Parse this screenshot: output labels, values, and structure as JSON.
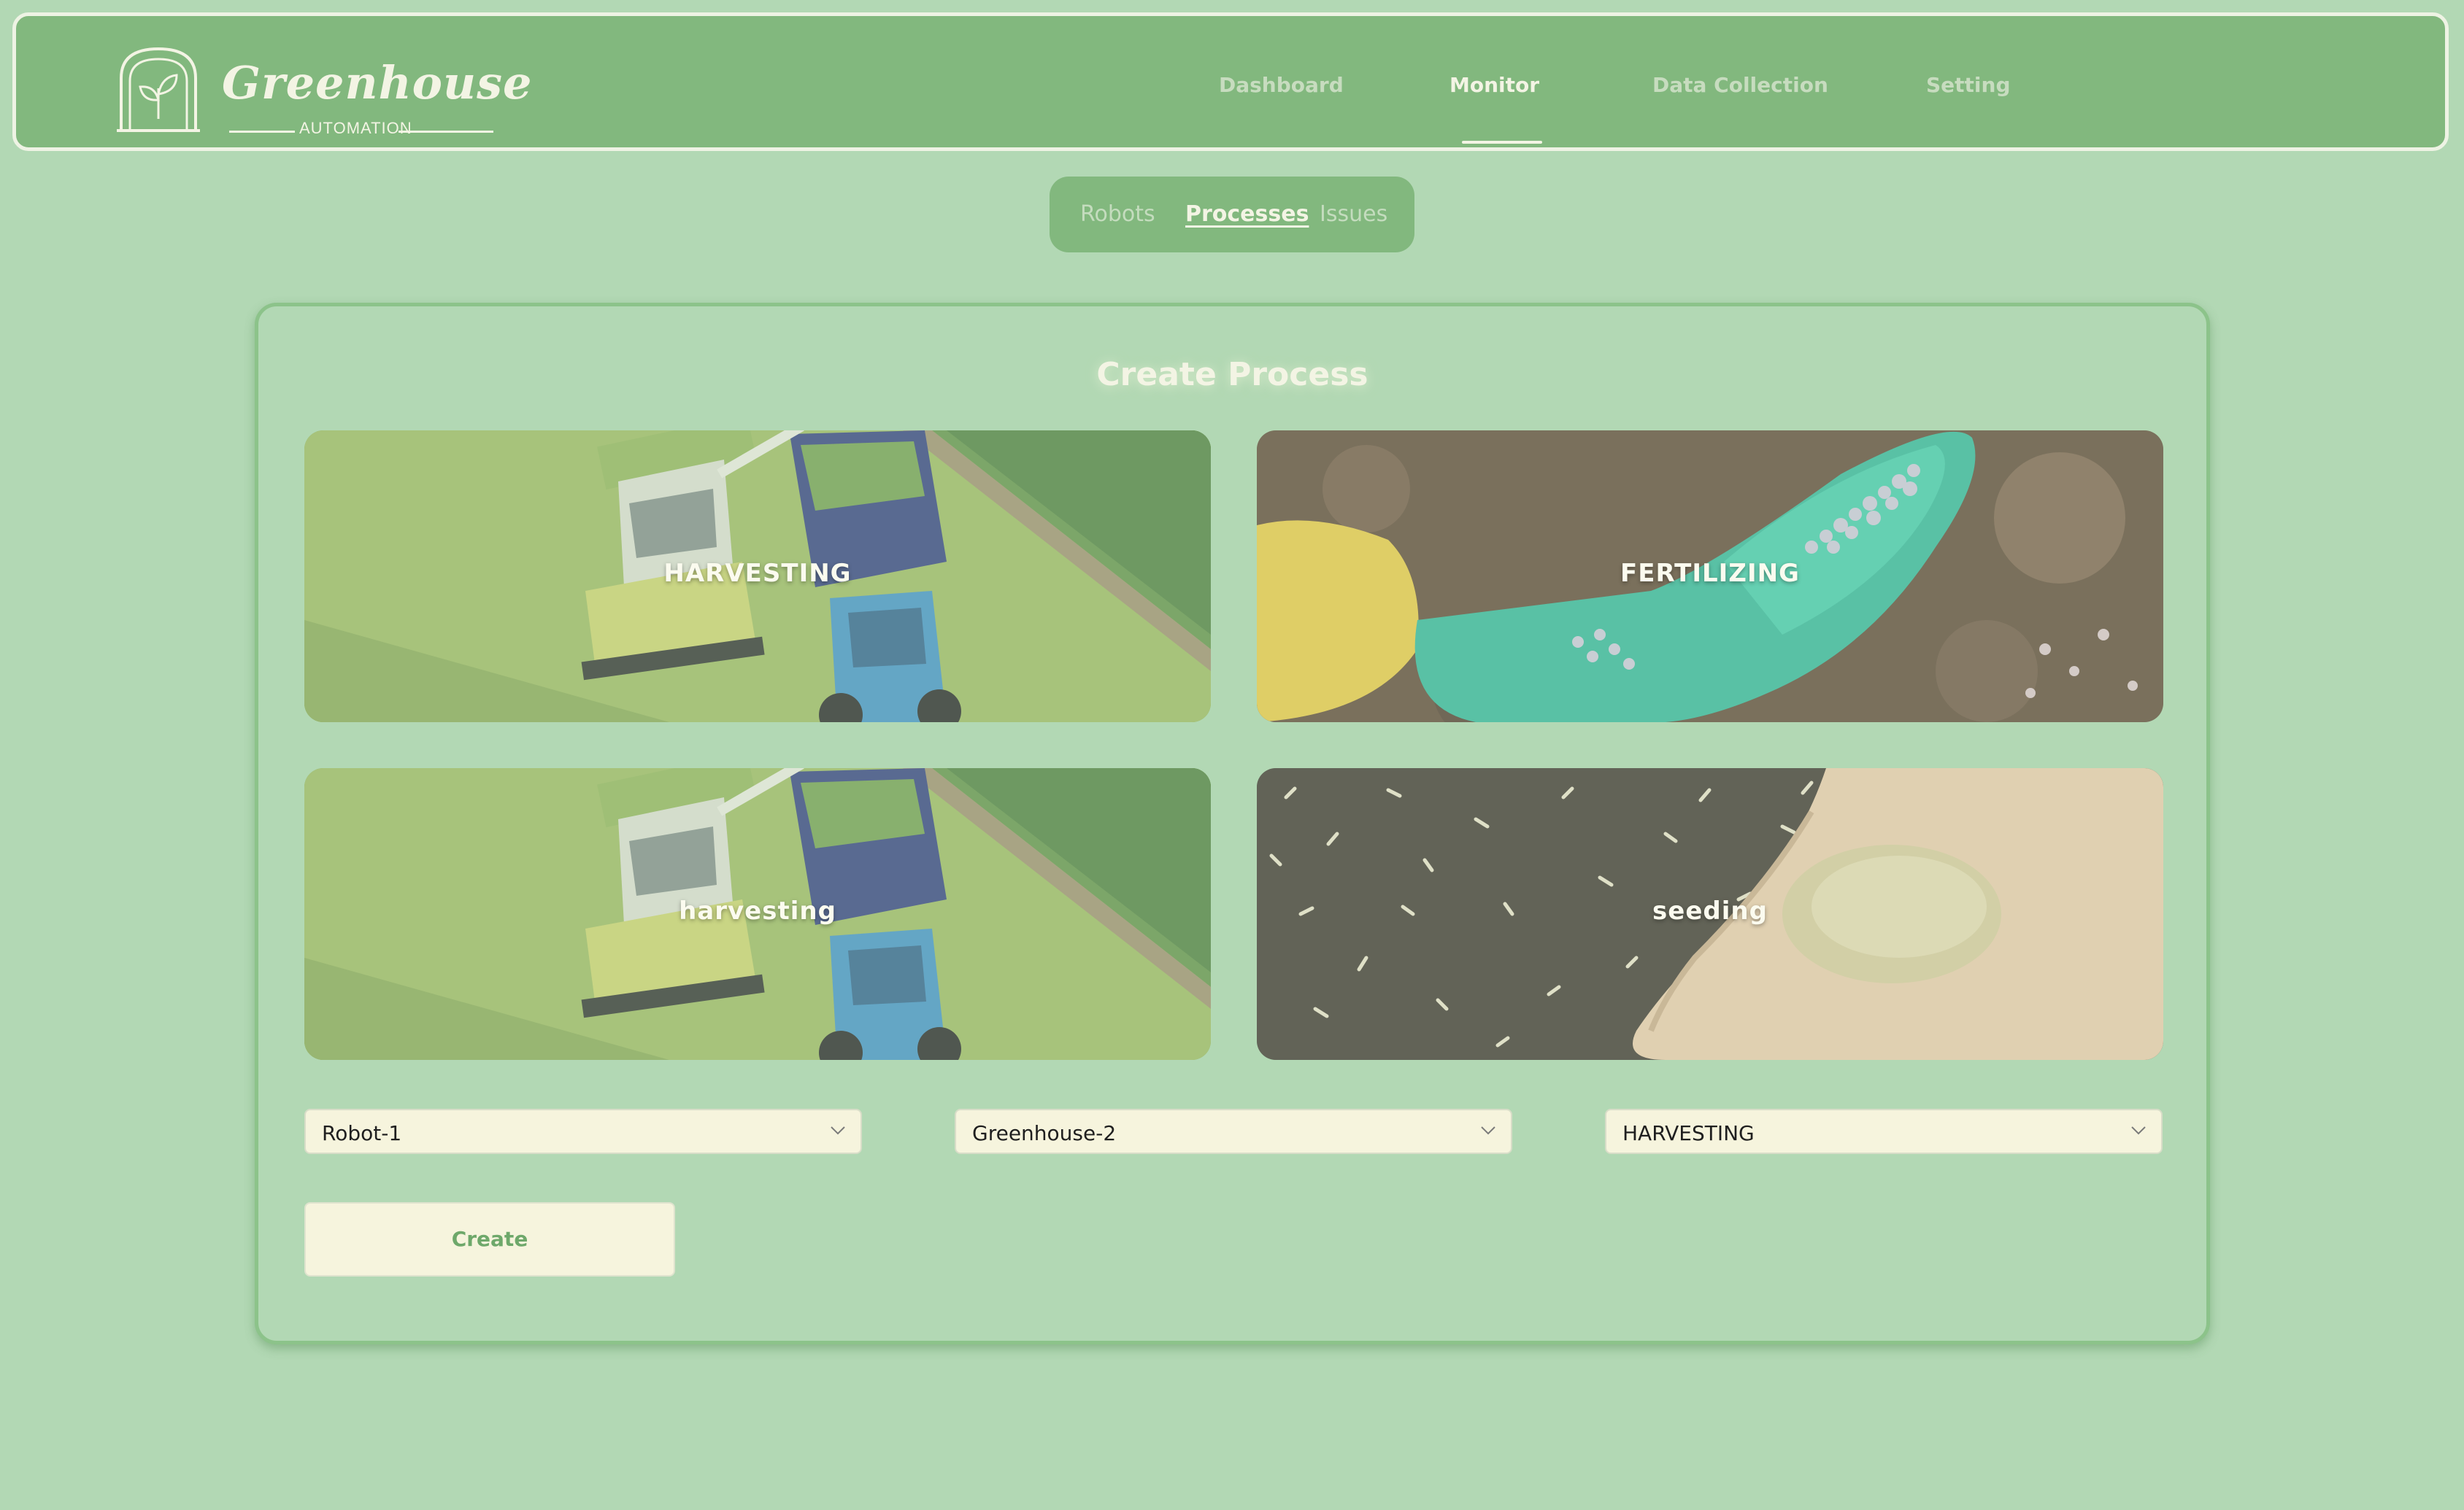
{
  "brand": {
    "name": "Greenhouse",
    "subtitle": "AUTOMATION"
  },
  "nav": {
    "items": [
      {
        "label": "Dashboard",
        "active": false
      },
      {
        "label": "Monitor",
        "active": true
      },
      {
        "label": "Data Collection",
        "active": false
      },
      {
        "label": "Setting",
        "active": false
      }
    ]
  },
  "subtabs": {
    "items": [
      {
        "label": "Robots",
        "active": false
      },
      {
        "label": "Processes",
        "active": true
      },
      {
        "label": "Issues",
        "active": false
      }
    ]
  },
  "card": {
    "title": "Create Process",
    "process_tiles": [
      {
        "label": "HARVESTING",
        "image": "harvester-field-photo"
      },
      {
        "label": "FERTILIZING",
        "image": "fertilizer-scoop-photo"
      },
      {
        "label": "harvesting",
        "image": "harvester-field-photo"
      },
      {
        "label": "seeding",
        "image": "seeds-in-hand-photo"
      }
    ],
    "selects": {
      "robot": {
        "value": "Robot-1"
      },
      "greenhouse": {
        "value": "Greenhouse-2"
      },
      "process": {
        "value": "HARVESTING"
      }
    },
    "create_label": "Create"
  },
  "colors": {
    "background": "#b2d8b4",
    "header": "#82b87e",
    "accent_text": "#f3f4e4",
    "input_bg": "#f6f4dd",
    "button_text": "#6ea86a"
  }
}
